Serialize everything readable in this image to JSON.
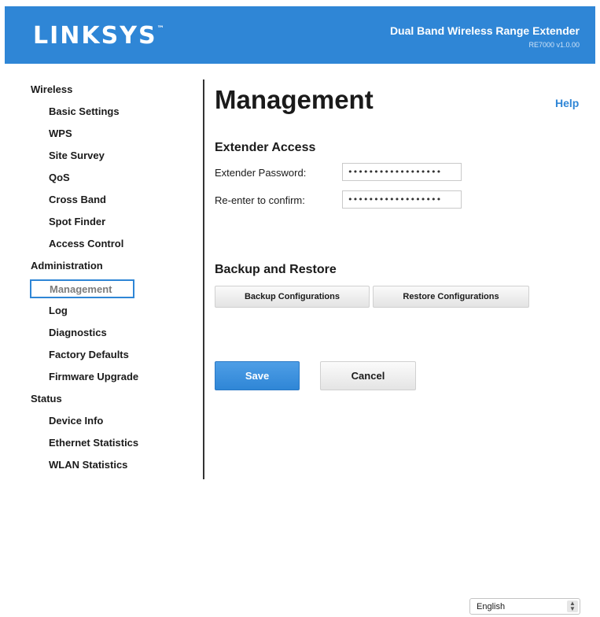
{
  "header": {
    "logo": "LINKSYS",
    "logo_mark": "™",
    "product": "Dual Band Wireless Range Extender",
    "model": "RE7000 v1.0.00"
  },
  "sidebar": {
    "groups": [
      {
        "label": "Wireless",
        "items": [
          "Basic Settings",
          "WPS",
          "Site Survey",
          "QoS",
          "Cross Band",
          "Spot Finder",
          "Access Control"
        ]
      },
      {
        "label": "Administration",
        "items": [
          "Management",
          "Log",
          "Diagnostics",
          "Factory Defaults",
          "Firmware Upgrade"
        ]
      },
      {
        "label": "Status",
        "items": [
          "Device Info",
          "Ethernet Statistics",
          "WLAN Statistics"
        ]
      }
    ],
    "active_item": "Management"
  },
  "main": {
    "title": "Management",
    "help": "Help",
    "extender_access": {
      "title": "Extender Access",
      "password_label": "Extender Password:",
      "password_value": "••••••••••••••••••",
      "confirm_label": "Re-enter to confirm:",
      "confirm_value": "••••••••••••••••••"
    },
    "backup": {
      "title": "Backup and Restore",
      "backup_label": "Backup Configurations",
      "restore_label": "Restore Configurations"
    },
    "save_label": "Save",
    "cancel_label": "Cancel"
  },
  "footer": {
    "language": "English"
  },
  "colors": {
    "brand_blue": "#2f86d6",
    "active_text": "#7c7c7c"
  }
}
